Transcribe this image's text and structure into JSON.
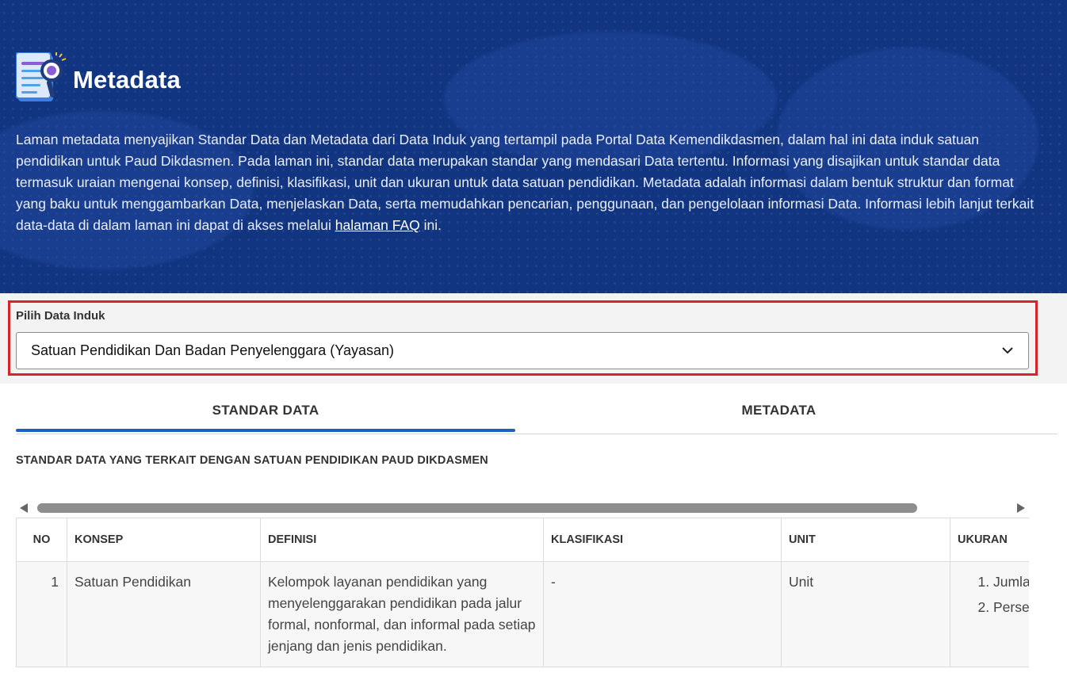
{
  "header": {
    "title": "Metadata",
    "description_text": "Laman metadata menyajikan Standar Data dan Metadata dari Data Induk yang tertampil pada Portal Data Kemendikdasmen, dalam hal ini data induk satuan pendidikan untuk Paud Dikdasmen. Pada laman ini, standar data merupakan standar yang mendasari Data tertentu. Informasi yang disajikan untuk standar data termasuk uraian mengenai konsep, definisi, klasifikasi, unit dan ukuran untuk data satuan pendidikan. Metadata adalah informasi dalam bentuk struktur dan format yang baku untuk menggambarkan Data, menjelaskan Data, serta memudahkan pencarian, penggunaan, dan pengelolaan informasi Data. Informasi lebih lanjut terkait data-data di dalam laman ini dapat di akses melalui",
    "faq_link": "halaman FAQ",
    "description_end": "ini."
  },
  "selector": {
    "label": "Pilih Data Induk",
    "selected": "Satuan Pendidikan Dan Badan Penyelenggara (Yayasan)"
  },
  "tabs": [
    {
      "label": "STANDAR DATA",
      "active": true
    },
    {
      "label": "METADATA",
      "active": false
    }
  ],
  "section": {
    "title": "STANDAR DATA YANG TERKAIT DENGAN SATUAN PENDIDIKAN PAUD DIKDASMEN"
  },
  "table": {
    "headers": [
      "NO",
      "KONSEP",
      "DEFINISI",
      "KLASIFIKASI",
      "UNIT",
      "UKURAN"
    ],
    "rows": [
      {
        "no": "1",
        "konsep": "Satuan Pendidikan",
        "definisi": "Kelompok layanan pendidikan yang menyelenggarakan pendidikan pada jalur formal, nonformal, dan informal pada setiap jenjang dan jenis pendidikan.",
        "klasifikasi": "-",
        "unit": "Unit",
        "ukuran": [
          "Jumla",
          "Perse"
        ]
      }
    ]
  },
  "colors": {
    "hero_bg": "#123581",
    "tab_indicator": "#1f5fc4",
    "highlight_border": "#d8232a"
  }
}
